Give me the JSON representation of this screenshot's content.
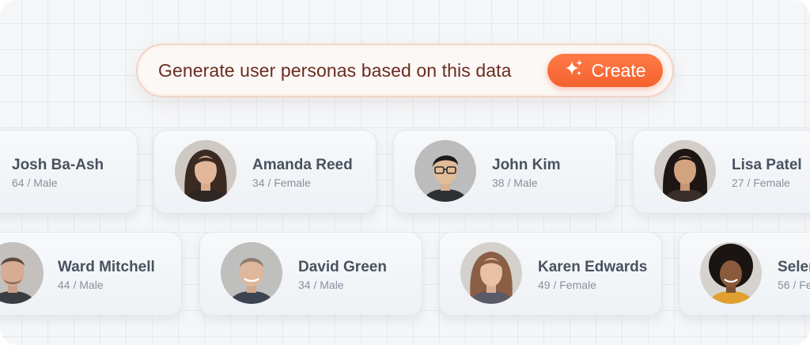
{
  "prompt": {
    "text": "Generate user personas based on this data",
    "button_label": "Create",
    "button_icon": "sparkles-icon"
  },
  "colors": {
    "accent": "#f4622d",
    "prompt_text": "#6b2c20",
    "name_text": "#4a525f",
    "meta_text": "#8a919c"
  },
  "personas": [
    {
      "name": "Josh Ba-Ash",
      "meta": "64 / Male"
    },
    {
      "name": "Amanda Reed",
      "meta": "34 / Female"
    },
    {
      "name": "John Kim",
      "meta": "38 / Male"
    },
    {
      "name": "Lisa Patel",
      "meta": "27 / Female"
    },
    {
      "name": "Ward Mitchell",
      "meta": "44 / Male"
    },
    {
      "name": "David Green",
      "meta": "34 / Male"
    },
    {
      "name": "Karen Edwards",
      "meta": "49 / Female"
    },
    {
      "name": "Selen",
      "meta": "56 / Fe"
    }
  ]
}
